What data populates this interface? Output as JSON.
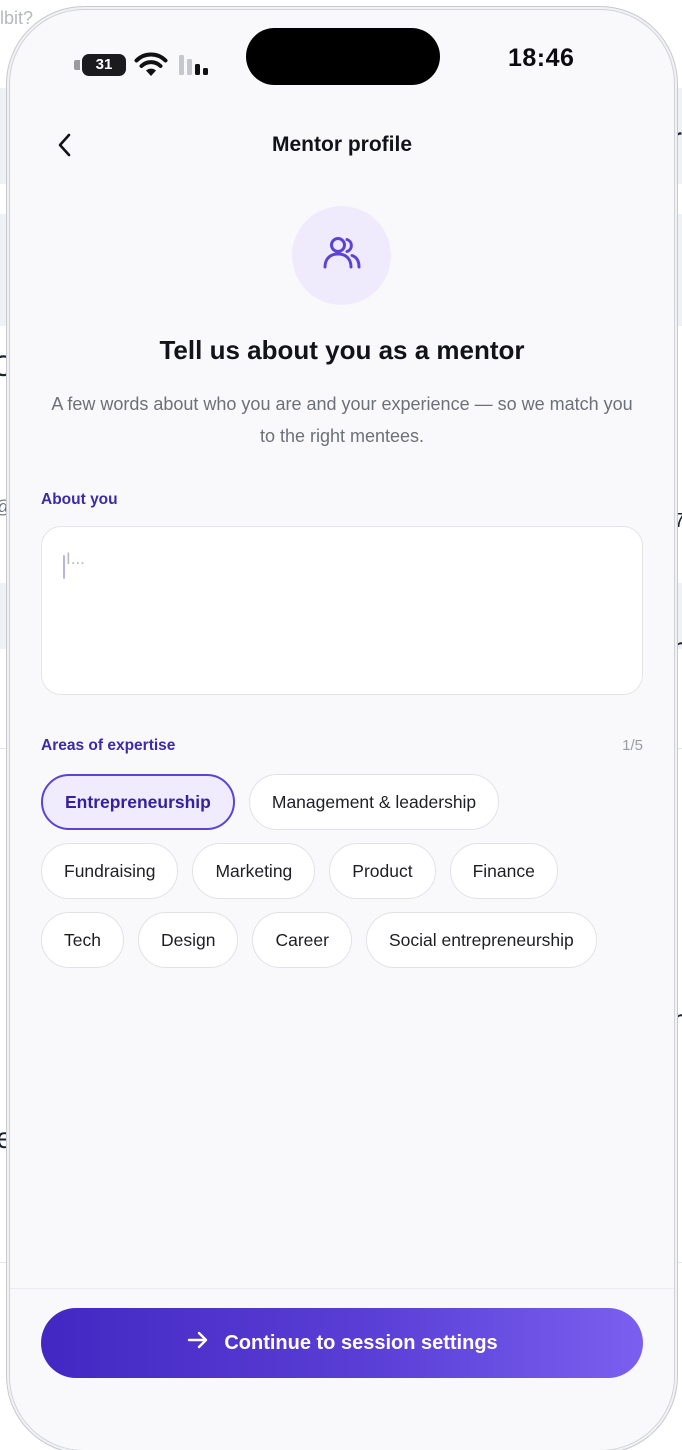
{
  "status_bar": {
    "battery_level": "31",
    "time": "18:46"
  },
  "nav": {
    "title": "Mentor profile",
    "back_icon": "chevron-left-icon"
  },
  "hero": {
    "icon": "users-icon",
    "heading": "Tell us about you as a mentor",
    "subtitle": "A few words about who you are and your experience — so we match you to the right mentees."
  },
  "about": {
    "label": "About you",
    "placeholder": "I...",
    "value": ""
  },
  "expertise": {
    "label": "Areas of expertise",
    "counter": "1/5",
    "rows": [
      [
        {
          "label": "Entrepreneurship",
          "selected": true
        },
        {
          "label": "Management & leadership",
          "selected": false
        }
      ],
      [
        {
          "label": "Fundraising",
          "selected": false
        },
        {
          "label": "Marketing",
          "selected": false
        },
        {
          "label": "Product",
          "selected": false
        },
        {
          "label": "Finance",
          "selected": false
        }
      ],
      [
        {
          "label": "Tech",
          "selected": false
        },
        {
          "label": "Design",
          "selected": false
        },
        {
          "label": "Career",
          "selected": false
        },
        {
          "label": "Social entrepreneurship",
          "selected": false
        }
      ]
    ]
  },
  "cta": {
    "icon": "arrow-right-icon",
    "label": "Continue to session settings"
  },
  "background_app": {
    "fragments": [
      "lbit?",
      "r",
      "C",
      "@",
      "7",
      "n",
      "n",
      "e"
    ]
  },
  "colors": {
    "accent": "#5b43d6",
    "accent_dark": "#3d2aa7",
    "chip_selected_bg": "#f1ecfd",
    "hero_icon_bg": "#f0ebfc",
    "cta_gradient_start": "#4327c2",
    "cta_gradient_end": "#7a5ff0"
  }
}
